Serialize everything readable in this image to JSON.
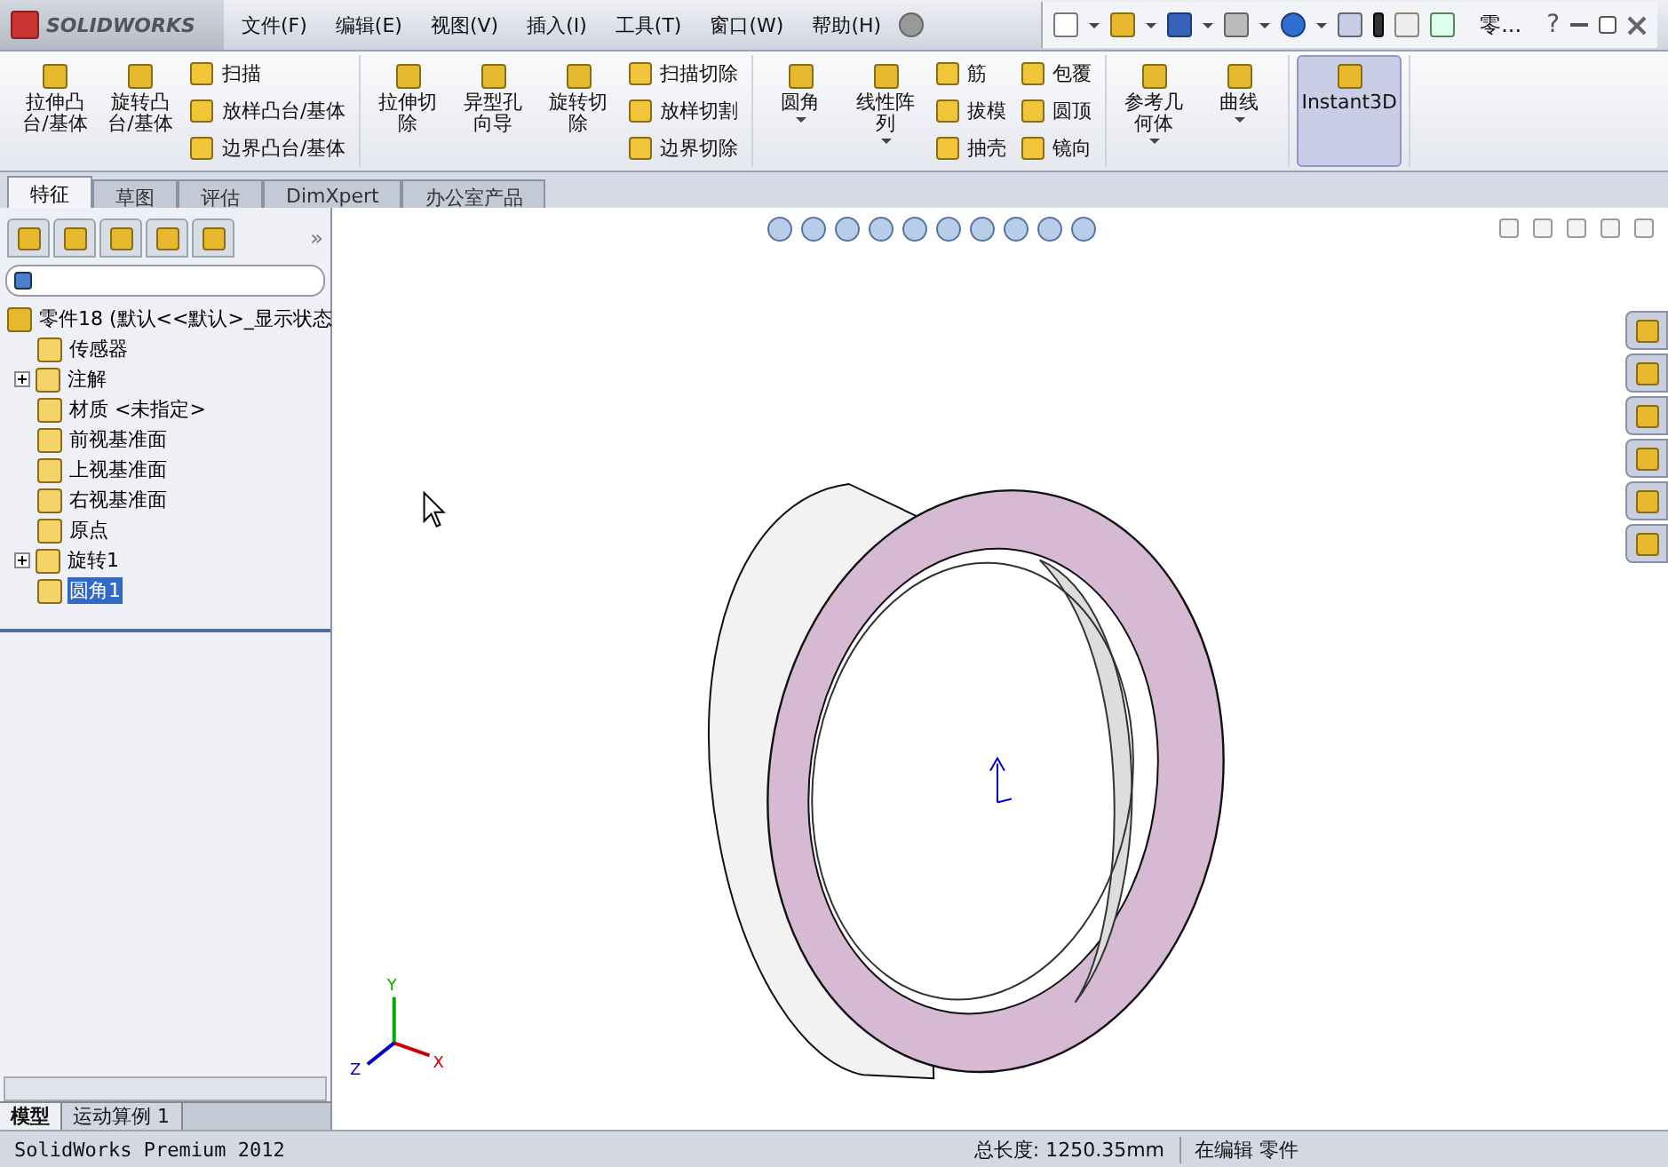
{
  "title_bar": {
    "logo": "SOLIDWORKS",
    "menu": [
      "文件(F)",
      "编辑(E)",
      "视图(V)",
      "插入(I)",
      "工具(T)",
      "窗口(W)",
      "帮助(H)"
    ],
    "document": "零...",
    "help": "?"
  },
  "ribbon": [
    {
      "items": [
        {
          "kind": "large",
          "label": "拉伸凸台/基体",
          "dropdown": false,
          "selected": false
        },
        {
          "kind": "large",
          "label": "旋转凸台/基体",
          "dropdown": false,
          "selected": false
        },
        {
          "kind": "stack",
          "labels": [
            "扫描",
            "放样凸台/基体",
            "边界凸台/基体"
          ]
        }
      ]
    },
    {
      "items": [
        {
          "kind": "large",
          "label": "拉伸切除",
          "dropdown": false,
          "selected": false
        },
        {
          "kind": "large",
          "label": "异型孔向导",
          "dropdown": false,
          "selected": false
        },
        {
          "kind": "large",
          "label": "旋转切除",
          "dropdown": false,
          "selected": false
        },
        {
          "kind": "stack",
          "labels": [
            "扫描切除",
            "放样切割",
            "边界切除"
          ]
        }
      ]
    },
    {
      "items": [
        {
          "kind": "large",
          "label": "圆角",
          "dropdown": true,
          "selected": false
        },
        {
          "kind": "large",
          "label": "线性阵列",
          "dropdown": true,
          "selected": false
        },
        {
          "kind": "stack",
          "labels": [
            "筋",
            "拔模",
            "抽壳"
          ]
        },
        {
          "kind": "stack",
          "labels": [
            "包覆",
            "圆顶",
            "镜向"
          ]
        }
      ]
    },
    {
      "items": [
        {
          "kind": "large",
          "label": "参考几何体",
          "dropdown": true,
          "selected": false
        },
        {
          "kind": "large",
          "label": "曲线",
          "dropdown": true,
          "selected": false
        }
      ]
    },
    {
      "items": [
        {
          "kind": "large",
          "label": "Instant3D",
          "dropdown": false,
          "selected": true
        }
      ]
    }
  ],
  "tabs": [
    {
      "label": "特征",
      "selected": true
    },
    {
      "label": "草图",
      "selected": false
    },
    {
      "label": "评估",
      "selected": false
    },
    {
      "label": "DimXpert",
      "selected": false
    },
    {
      "label": "办公室产品",
      "selected": false
    }
  ],
  "panel": {
    "expand": "»"
  },
  "tree": {
    "label": "零件18  (默认<<默认>_显示状态",
    "children": [
      {
        "label": "传感器",
        "collapsed": false,
        "selected": false
      },
      {
        "label": "注解",
        "collapsed": true,
        "selected": false
      },
      {
        "label": "材质 <未指定>",
        "collapsed": false,
        "selected": false
      },
      {
        "label": "前视基准面",
        "collapsed": false,
        "selected": false
      },
      {
        "label": "上视基准面",
        "collapsed": false,
        "selected": false
      },
      {
        "label": "右视基准面",
        "collapsed": false,
        "selected": false
      },
      {
        "label": "原点",
        "collapsed": false,
        "selected": false
      },
      {
        "label": "旋转1",
        "collapsed": true,
        "selected": false
      },
      {
        "label": "圆角1",
        "collapsed": false,
        "selected": true
      }
    ]
  },
  "triad": [
    "Y",
    "Z",
    "X"
  ],
  "bottom_tabs": [
    {
      "label": "模型",
      "selected": true
    },
    {
      "label": "运动算例 1",
      "selected": false
    }
  ],
  "status_bar": {
    "product": "SolidWorks Premium 2012",
    "measure": "总长度: 1250.35mm",
    "mode": "在编辑 零件"
  }
}
